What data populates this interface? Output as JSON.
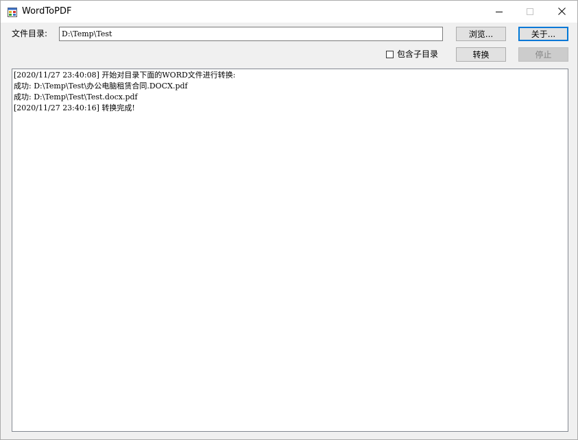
{
  "window": {
    "title": "WordToPDF"
  },
  "form": {
    "dir_label": "文件目录:",
    "dir_value": "D:\\Temp\\Test",
    "include_subdirs_label": "包含子目录",
    "include_subdirs_checked": false
  },
  "buttons": {
    "browse": "浏览...",
    "about": "关于...",
    "convert": "转换",
    "stop": "停止"
  },
  "log": {
    "lines": [
      "[2020/11/27 23:40:08] 开始对目录下面的WORD文件进行转换:",
      "成功: D:\\Temp\\Test\\办公电脑租赁合同.DOCX.pdf",
      "成功: D:\\Temp\\Test\\Test.docx.pdf",
      "[2020/11/27 23:40:16] 转换完成!"
    ]
  },
  "icons": {
    "app": "app-icon",
    "minimize": "minimize-icon",
    "maximize": "maximize-icon",
    "close": "close-icon"
  }
}
